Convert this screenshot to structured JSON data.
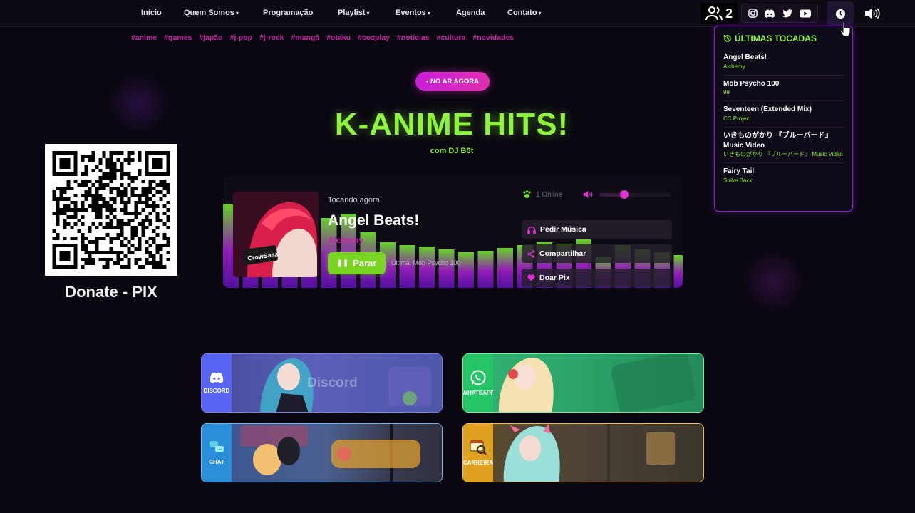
{
  "nav": {
    "items": [
      {
        "label": "Início"
      },
      {
        "label": "Quem Somos"
      },
      {
        "label": "Programação"
      },
      {
        "label": "Playlist"
      },
      {
        "label": "Eventos"
      },
      {
        "label": "Agenda"
      },
      {
        "label": "Contato"
      }
    ],
    "listeners_count": "2"
  },
  "tags": [
    "#anime",
    "#games",
    "#japão",
    "#j-pop",
    "#j-rock",
    "#mangá",
    "#otaku",
    "#cosplay",
    "#notícias",
    "#cultura",
    "#novidades"
  ],
  "hero": {
    "live_badge": "• NO AR AGORA",
    "show_title": "K-ANIME HITS!",
    "dj": "com DJ B0t"
  },
  "donate": {
    "label": "Donate - PIX"
  },
  "player": {
    "now_label": "Tocando agora",
    "track_title": "Angel Beats!",
    "track_artist": "Alchemy",
    "stop_label": "Parar",
    "last_played": "Última: Mob Psycho 100",
    "online": "1 Online",
    "volume": 0.35,
    "request_label": "Pedir Música",
    "share_label": "Compartilhar",
    "donate_label": "Doar Pix",
    "cover_text": "CrowSasa"
  },
  "history": {
    "title": "ÚLTIMAS TOCADAS",
    "items": [
      {
        "song": "Angel Beats!",
        "artist": "Alchemy"
      },
      {
        "song": "Mob Psycho 100",
        "artist": "99"
      },
      {
        "song": "Seventeen (Extended Mix)",
        "artist": "CC Project"
      },
      {
        "song": "いきものがかり 『ブルーバード』 Music Video",
        "artist": "いきものがかり 『ブルーバード』 Music Video"
      },
      {
        "song": "Fairy Tail",
        "artist": "Strike Back"
      }
    ]
  },
  "cards": [
    {
      "label": "DISCORD",
      "art_text": "Discord",
      "color": "#5865f2"
    },
    {
      "label": "WHATSAPP",
      "art_text": "",
      "color": "#25c466"
    },
    {
      "label": "CHAT",
      "art_text": "",
      "color": "#2a8fd8"
    },
    {
      "label": "CARREIRA",
      "art_text": "",
      "color": "#e0a020"
    }
  ],
  "colors": {
    "accent_green": "#8ef53a",
    "accent_pink": "#c428a8",
    "accent_purple": "#8a1fd0",
    "background": "#0a0710"
  }
}
